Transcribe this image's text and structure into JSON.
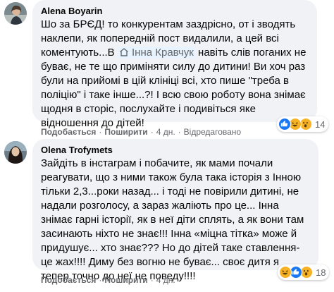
{
  "comments": [
    {
      "author": "Alena Boyarin",
      "text_before": "Шо за БРЄД! то конкурентам заздрісно, от і зводять наклепи, як попередній пост видалили, а цей всі коментують...В",
      "mention": "Інна Кравчук",
      "text_after": "навіть слів поганих не буває, не те що приміняти силу до дитини! Ви хоч раз були на прийомі в цій клініці всі, хто пише \"треба в поліцію\" і таке інше...?! І всю свою роботу вона знімає щодня в сторіс, послухайте і подивіться яке відношення до дітей!",
      "actions": {
        "like": "Подобається",
        "share": "Поширити",
        "time": "4 дн.",
        "edited": "Відредаговано"
      },
      "reaction_count": "14",
      "reaction_icons": [
        "like-icon",
        "haha-icon",
        "wow-icon"
      ]
    },
    {
      "author": "Olena Trofymets",
      "text": "Зайдіть в інстаграм і побачите, як мами почали реагувати, що з ними також була така історія з Інною тільки 2,3...роки назад... і тоді не повірили дитині, не надали розголосу, а зараз жаліють про це... Інна знімає гарні історії, як в неї діти сплять, а як вони там засинають ніхто не знає!!! Інна «міцна тітка» може й придушує... хто знає??? Но до дітей таке ставлення- це жах!!!! Диму без вогню не буває... своє дитя я тепер точно до неї не поведу!!!!",
      "actions": {
        "like": "Подобається",
        "share": "Поширити",
        "time": "4 дн."
      },
      "reaction_count": "18",
      "reaction_icons": [
        "haha-icon",
        "like-icon",
        "wow-icon"
      ]
    }
  ],
  "colors": {
    "bubble": "#f0f2f5",
    "like": "#1877f2",
    "emoji": "#f7b125",
    "secondary_text": "#65676b"
  }
}
